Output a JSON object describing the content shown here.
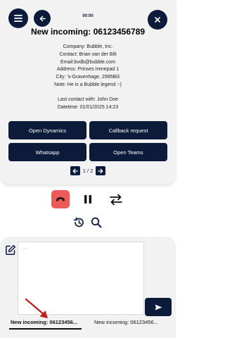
{
  "header": {
    "timer": "00:00",
    "title": "New incoming: 06123456789"
  },
  "contact": {
    "company": "Company: Bubble, Inc.",
    "contact": "Contact: Brian van der Bilt",
    "email": "Email:bvdb@bubble.com",
    "address": "Address: Prinses Irenepad 1",
    "city": "City: 's-Gravenhage, 2995BG",
    "note": "Note: He is a Bubble legend :-)",
    "last_contact": "Last contact with: John Doe",
    "datetime": "Datetime: 01/01/2025 14:23"
  },
  "actions": {
    "open_dynamics": "Open Dynamics",
    "callback_request": "Callback request",
    "whatsapp": "Whatsapp",
    "open_teams": "Open Teams"
  },
  "pager": {
    "label": "1 / 2"
  },
  "notes": {
    "placeholder": "..."
  },
  "tabs": [
    {
      "label": "New incoming: 06123456..."
    },
    {
      "label": "New incoming: 06123456..."
    }
  ],
  "colors": {
    "primary": "#0d1b3a",
    "hangup": "#ee5a5a",
    "annotation_arrow": "#c0221c",
    "panel_bg": "#f2f2f2"
  },
  "icons": {
    "menu": "hamburger-menu-icon",
    "back": "arrow-left-icon",
    "close": "close-icon",
    "hangup": "phone-hangup-icon",
    "pause": "pause-icon",
    "transfer": "transfer-arrows-icon",
    "history": "history-icon",
    "search": "search-icon",
    "edit": "edit-note-icon",
    "send": "send-icon"
  }
}
